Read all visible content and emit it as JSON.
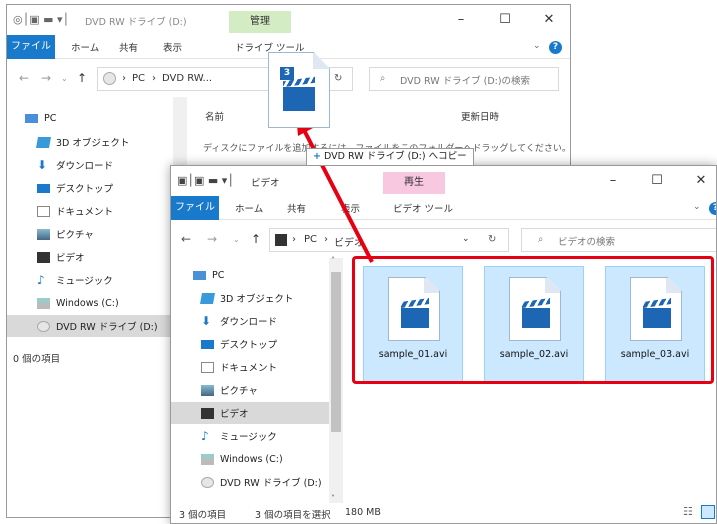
{
  "back_window": {
    "title": "DVD RW ドライブ (D:)",
    "context_tab": "管理",
    "ribbon_tabs": [
      "ファイル",
      "ホーム",
      "共有",
      "表示",
      "ドライブ ツール"
    ],
    "address_pc": "PC",
    "address_current": "DVD RW...",
    "search_placeholder": "DVD RW ドライブ (D:)の検索",
    "column_name": "名前",
    "column_date": "更新日時",
    "empty_message": "ディスクにファイルを追加するには、ファイルをこのフォルダーへドラッグしてください。",
    "tree": [
      "PC",
      "3D オブジェクト",
      "ダウンロード",
      "デスクトップ",
      "ドキュメント",
      "ピクチャ",
      "ビデオ",
      "ミュージック",
      "Windows (C:)",
      "DVD RW ドライブ (D:)"
    ],
    "status": "0 個の項目"
  },
  "front_window": {
    "title": "ビデオ",
    "context_tab": "再生",
    "ribbon_tabs": [
      "ファイル",
      "ホーム",
      "共有",
      "表示",
      "ビデオ ツール"
    ],
    "address_pc": "PC",
    "address_current": "ビデオ",
    "search_placeholder": "ビデオの検索",
    "tree": [
      "PC",
      "3D オブジェクト",
      "ダウンロード",
      "デスクトップ",
      "ドキュメント",
      "ピクチャ",
      "ビデオ",
      "ミュージック",
      "Windows (C:)",
      "DVD RW ドライブ (D:)"
    ],
    "files": [
      "sample_01.avi",
      "sample_02.avi",
      "sample_03.avi"
    ],
    "status_count": "3 個の項目",
    "status_selected": "3 個の項目を選択",
    "status_size": "180 MB"
  },
  "drag": {
    "count_badge": "3",
    "tooltip_prefix": "+",
    "tooltip_text": "DVD RW ドライブ (D:) へコピー"
  },
  "colors": {
    "accent": "#1979ca",
    "highlight": "#e60012",
    "management_tab": "#d4ecc4",
    "playback_tab": "#f7c8e0"
  }
}
